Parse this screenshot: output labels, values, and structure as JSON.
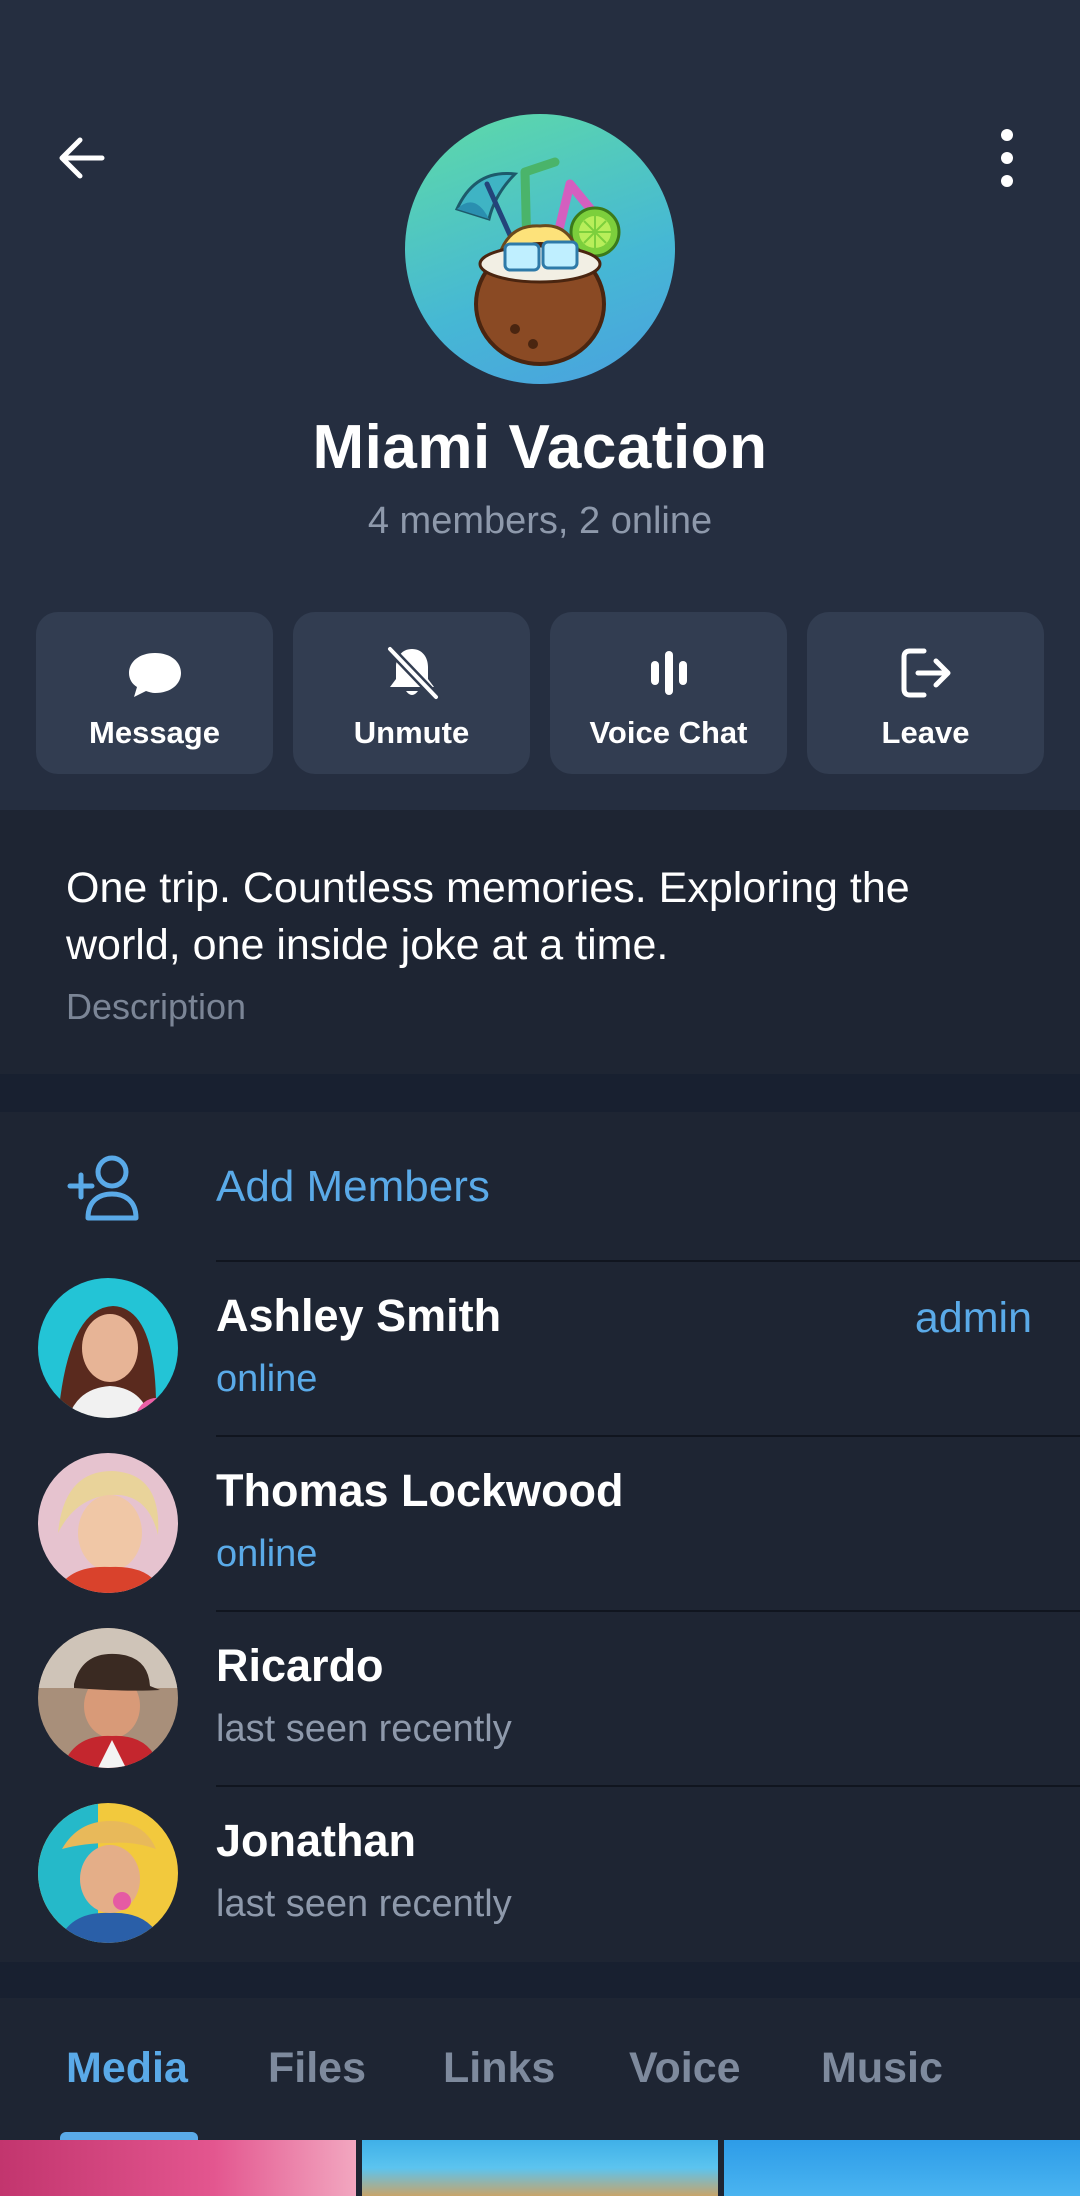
{
  "header": {
    "title": "Miami Vacation",
    "subtitle": "4 members, 2 online",
    "back_icon": "arrow-left-icon",
    "more_icon": "more-vertical-icon"
  },
  "actions": [
    {
      "label": "Message",
      "icon": "chat-bubble-icon"
    },
    {
      "label": "Unmute",
      "icon": "bell-off-icon"
    },
    {
      "label": "Voice Chat",
      "icon": "voice-bars-icon"
    },
    {
      "label": "Leave",
      "icon": "logout-icon"
    }
  ],
  "description": {
    "text": "One trip. Countless memories. Exploring the world, one inside joke at a time.",
    "label": "Description"
  },
  "add_members": {
    "label": "Add Members",
    "icon": "add-person-icon"
  },
  "members": [
    {
      "name": "Ashley Smith",
      "status": "online",
      "role": "admin",
      "online": true
    },
    {
      "name": "Thomas Lockwood",
      "status": "online",
      "online": true
    },
    {
      "name": "Ricardo",
      "status": "last seen recently",
      "online": false
    },
    {
      "name": "Jonathan",
      "status": "last seen recently",
      "online": false
    }
  ],
  "tabs": [
    "Media",
    "Files",
    "Links",
    "Voice",
    "Music"
  ],
  "active_tab": "Media",
  "colors": {
    "accent": "#5aaae8",
    "background": "#1e2533",
    "header": "#252e40",
    "button": "#323d51"
  }
}
